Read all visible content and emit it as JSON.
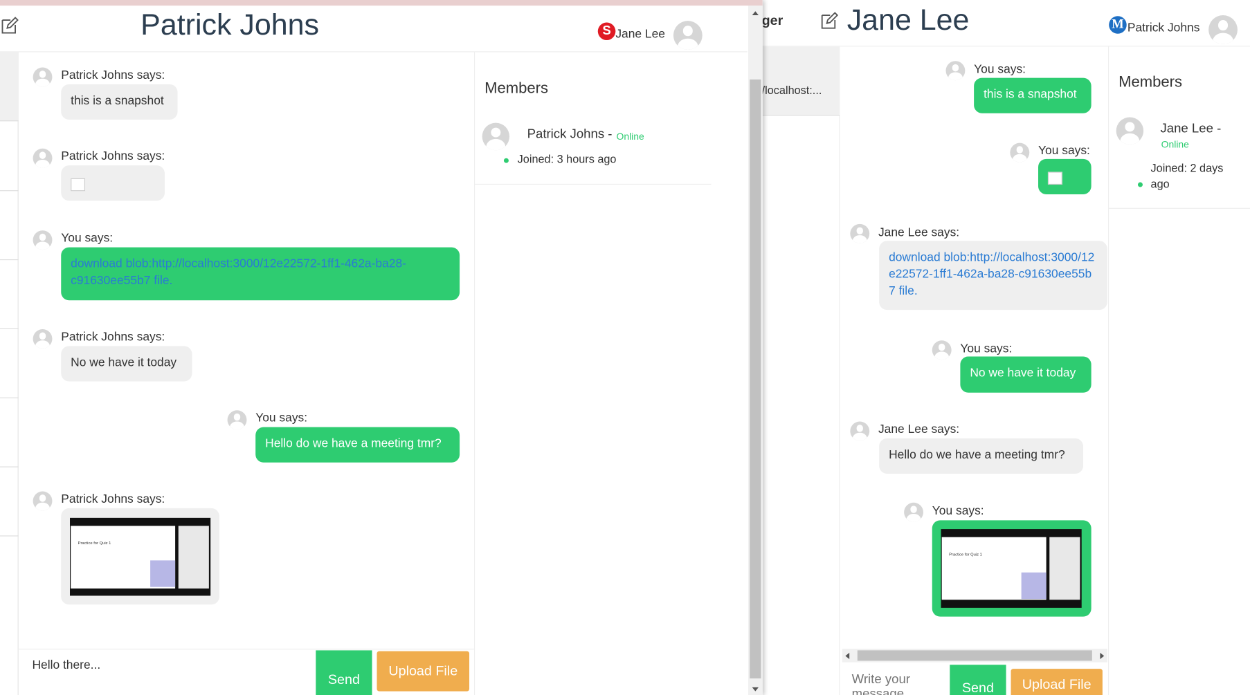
{
  "left_window": {
    "title": "Patrick Johns",
    "current_user": {
      "badge": "S",
      "name": "Jane Lee"
    },
    "messages": [
      {
        "author": "Patrick Johns says:",
        "text": "this is a snapshot"
      },
      {
        "author": "Patrick Johns says:",
        "text": ""
      },
      {
        "author": "You says:",
        "text": "download blob:http://localhost:3000/12e22572-1ff1-462a-ba28-c91630ee55b7 file."
      },
      {
        "author": "Patrick Johns says:",
        "text": "No we have it today"
      },
      {
        "author": "You says:",
        "text": "Hello do we have a meeting tmr?"
      },
      {
        "author": "Patrick Johns says:",
        "text": ""
      }
    ],
    "thumbnail_title": "Practice for Quiz 1",
    "members": {
      "heading": "Members",
      "items": [
        {
          "name": "Patrick Johns -",
          "status": "Online",
          "joined": "Joined: 3 hours ago"
        }
      ]
    },
    "composer": {
      "value": "Hello there...",
      "send": "Send",
      "upload": "Upload File"
    }
  },
  "right_window": {
    "app_fragment": "ger",
    "title": "Jane Lee",
    "current_user": {
      "badge": "M",
      "name": "Patrick Johns"
    },
    "sidebar_fragment": "/localhost:...",
    "messages": [
      {
        "author": "You says:",
        "text": "this is a snapshot"
      },
      {
        "author": "You says:",
        "text": ""
      },
      {
        "author": "Jane Lee says:",
        "text": "download blob:http://localhost:3000/12e22572-1ff1-462a-ba28-c91630ee55b7 file."
      },
      {
        "author": "You says:",
        "text": "No we have it today"
      },
      {
        "author": "Jane Lee says:",
        "text": "Hello do we have a meeting tmr?"
      },
      {
        "author": "You says:",
        "text": ""
      }
    ],
    "thumbnail_title": "Practice for Quiz 1",
    "members": {
      "heading": "Members",
      "items": [
        {
          "name": "Jane Lee -",
          "status": "Online",
          "joined": "Joined: 2 days ago"
        }
      ]
    },
    "composer": {
      "placeholder": "Write your message",
      "send": "Send",
      "upload": "Upload File"
    }
  },
  "colors": {
    "green": "#2ecc71",
    "orange": "#f0ad4e",
    "online": "#2ecc71",
    "badge_s": "#e01b24",
    "badge_m": "#1e6fc4",
    "topbar": "#e9cfcf"
  }
}
